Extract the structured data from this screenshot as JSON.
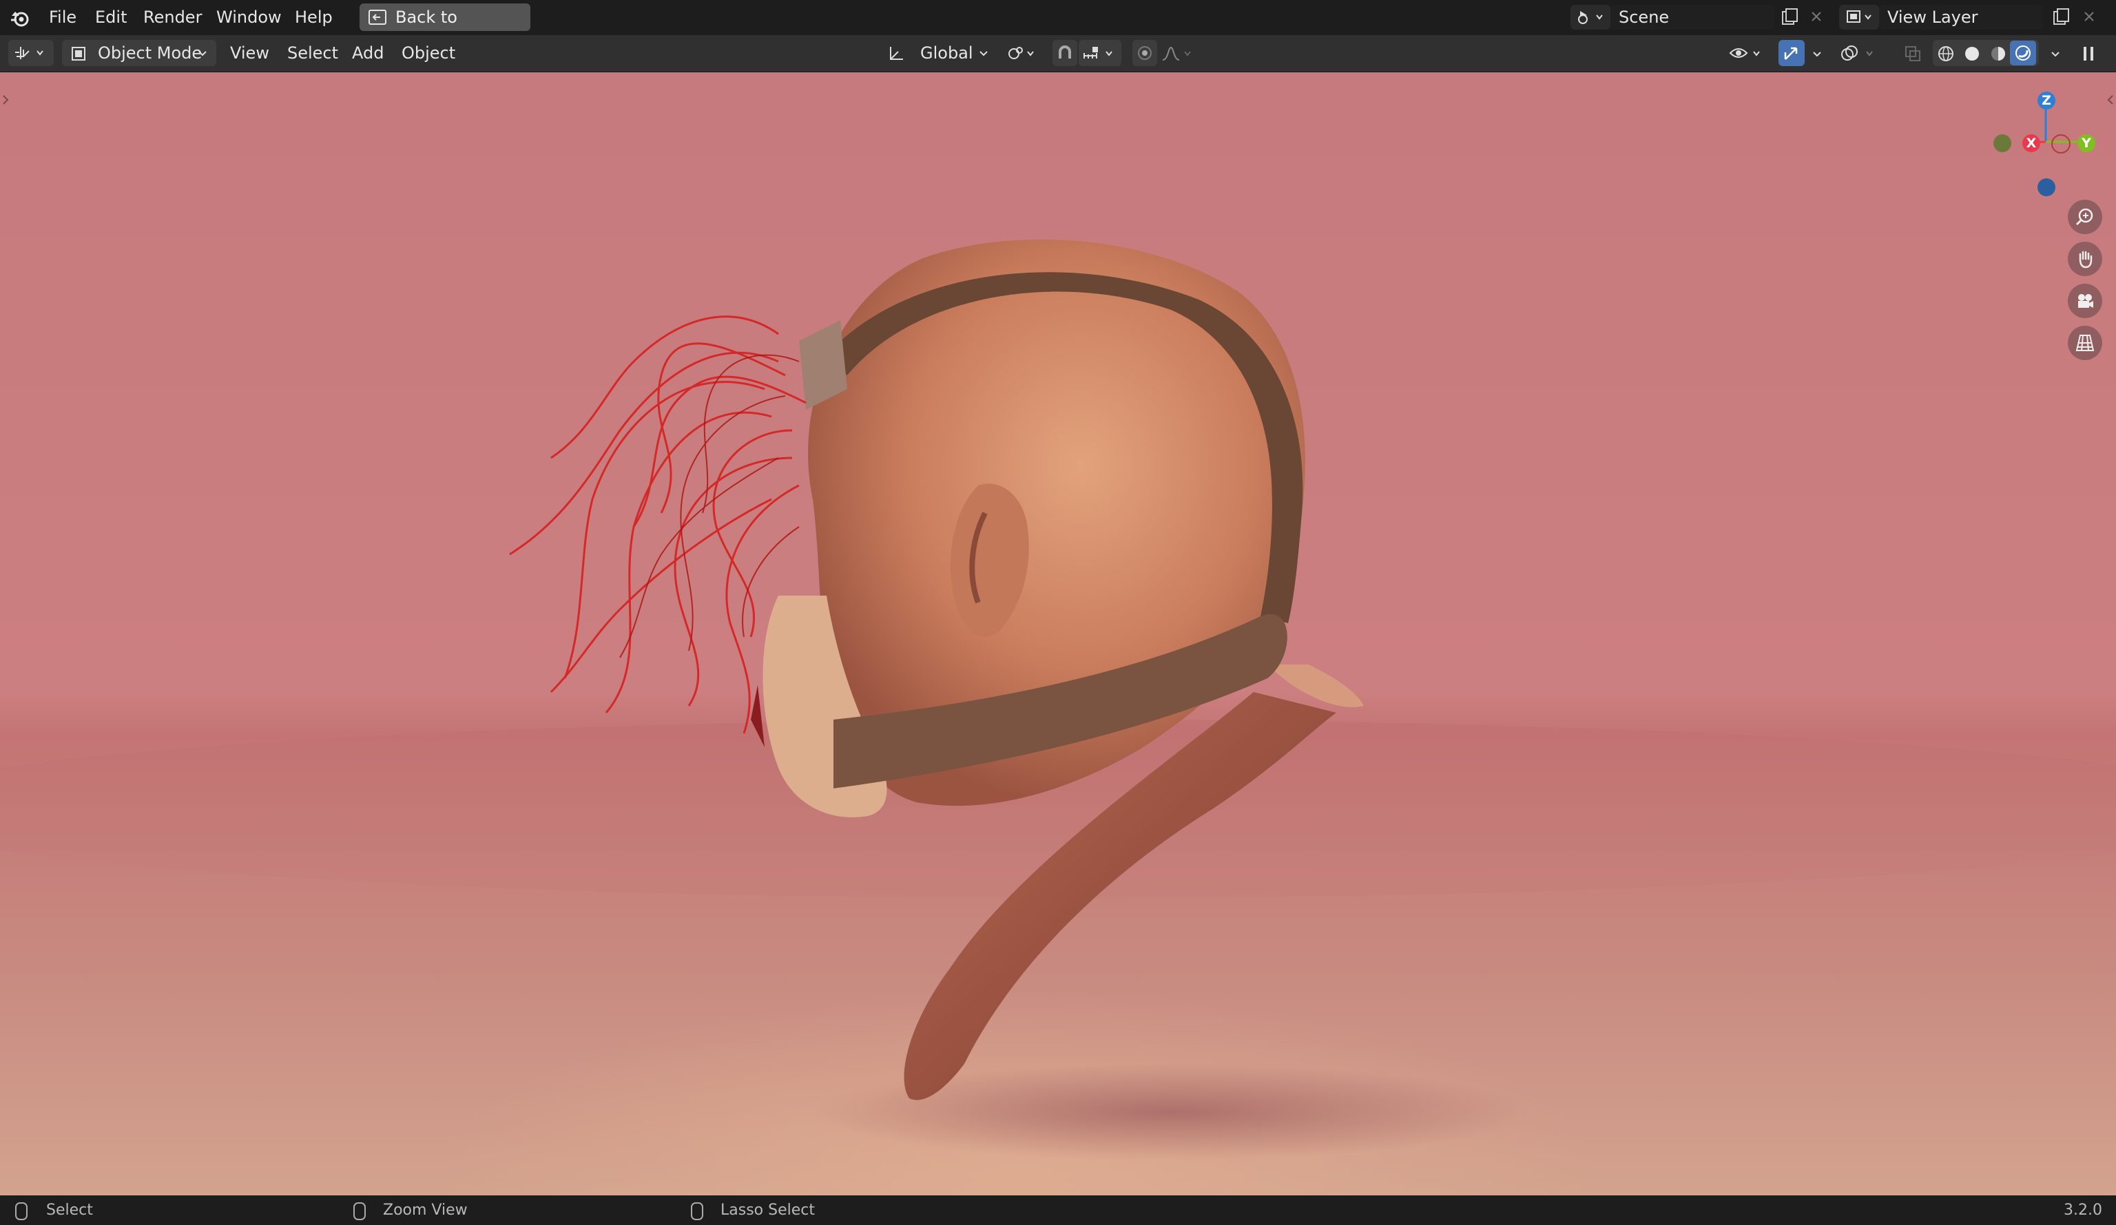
{
  "menu": {
    "file": "File",
    "edit": "Edit",
    "render": "Render",
    "window": "Window",
    "help": "Help",
    "back_button": "Back to Previous"
  },
  "scene": {
    "label": "Scene",
    "view_layer": "View Layer"
  },
  "toolbar": {
    "mode": "Object Mode",
    "view": "View",
    "select": "Select",
    "add": "Add",
    "object": "Object",
    "orientation": "Global"
  },
  "gizmo": {
    "z": "Z",
    "x": "X",
    "y": "Y"
  },
  "status": {
    "select": "Select",
    "zoom": "Zoom View",
    "lasso": "Lasso Select",
    "version": "3.2.0"
  },
  "colors": {
    "axis_x": "#e8394d",
    "axis_y": "#7fbf1f",
    "axis_z": "#2e7fd6",
    "accent": "#4772b3",
    "viewport_bg": "#c67a7d"
  }
}
